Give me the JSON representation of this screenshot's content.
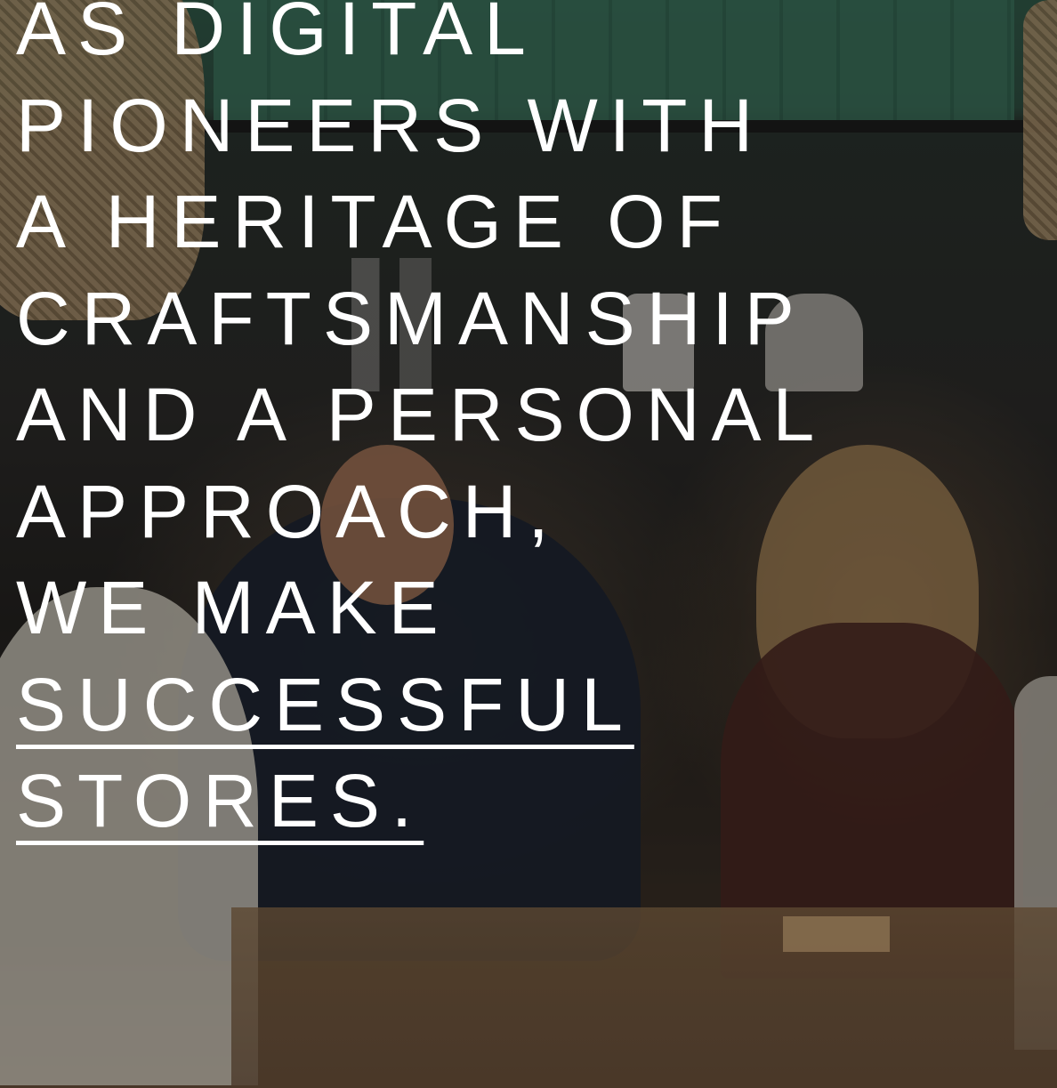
{
  "hero": {
    "background_image_alt": "team meeting around a table",
    "headline": {
      "line_1": "AS DIGITAL",
      "line_2": "PIONEERS WITH",
      "line_3": "A HERITAGE OF",
      "line_4": "CRAFTSMANSHIP",
      "line_5": "AND A PERSONAL",
      "line_6": "APPROACH,",
      "line_7": "WE MAKE",
      "link_1": "SUCCESSFUL",
      "link_2": "STORES."
    }
  },
  "colors": {
    "text": "#ffffff",
    "wall_green": "#3d7a61"
  }
}
